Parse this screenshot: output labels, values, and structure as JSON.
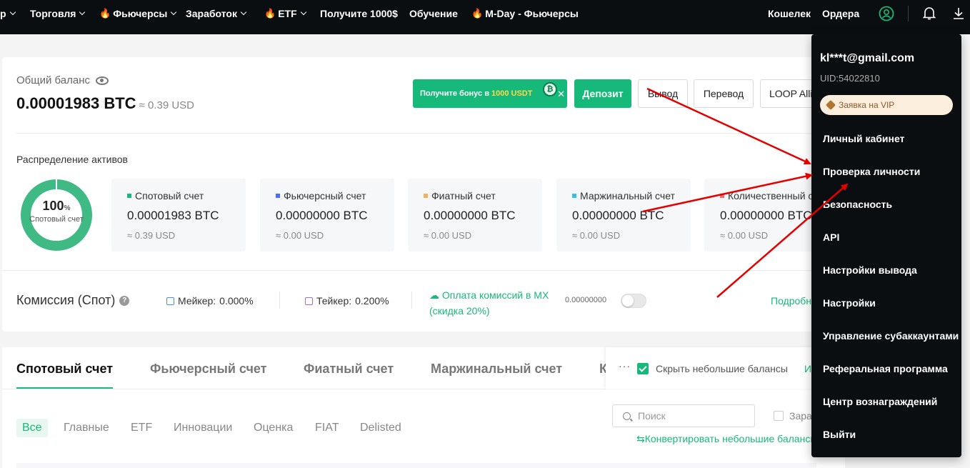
{
  "nav": {
    "items": [
      {
        "label": "р",
        "x": 0
      },
      {
        "label": "Торговля"
      },
      {
        "label": "Фьючерсы"
      },
      {
        "label": "Заработок"
      },
      {
        "label": "ETF"
      },
      {
        "label": "Получите 1000$"
      },
      {
        "label": "Обучение"
      },
      {
        "label": "M-Day - Фьючерсы"
      }
    ],
    "wallet": "Кошелек",
    "orders": "Ордера"
  },
  "balance": {
    "label": "Общий баланс",
    "btc": "0.00001983 BTC",
    "usd": "≈ 0.39 USD"
  },
  "actions": {
    "banner_text": "Получите бонус в",
    "banner_amount": "1000 USDT",
    "deposit": "Депозит",
    "withdraw": "Вывод",
    "transfer": "Перевод",
    "loop": "LOOP Alli"
  },
  "distribution": {
    "label": "Распределение активов",
    "percent": "100",
    "percent_sign": "%",
    "sub": "Спотовый счет",
    "accounts": [
      {
        "name": "Спотовый счет",
        "btc": "0.00001983 BTC",
        "usd": "≈ 0.39 USD",
        "color": "#16b979"
      },
      {
        "name": "Фьючерсный счет",
        "btc": "0.00000000 BTC",
        "usd": "≈ 0.00 USD",
        "color": "#4a6cf7"
      },
      {
        "name": "Фиатный счет",
        "btc": "0.00000000 BTC",
        "usd": "≈ 0.00 USD",
        "color": "#f5b05a"
      },
      {
        "name": "Маржинальный счет",
        "btc": "0.00000000 BTC",
        "usd": "≈ 0.00 USD",
        "color": "#35c0e8"
      },
      {
        "name": "Количественный с",
        "btc": "0.00000000 BTC",
        "usd": "≈ 0.00 USD",
        "color": "#e96f6f"
      }
    ]
  },
  "fees": {
    "title": "Комиссия (Спот)",
    "maker_label": "Мейкер:",
    "maker_value": "0.000%",
    "taker_label": "Тейкер:",
    "taker_value": "0.200%",
    "mx_line1": "Оплата комиссий в MX",
    "mx_line2": "(скидка 20%)",
    "mx_value": "0.00000000",
    "details": "Подробн"
  },
  "tabs": [
    "Спотовый счет",
    "Фьючерсный счет",
    "Фиатный счет",
    "Маржинальный счет",
    "К"
  ],
  "tools": {
    "dots": "···",
    "hide_small": "Скрыть небольшие балансы",
    "extra": "И"
  },
  "filters": [
    "Все",
    "Главные",
    "ETF",
    "Инновации",
    "Оценка",
    "FIAT",
    "Delisted"
  ],
  "search": {
    "placeholder": "Поиск"
  },
  "zar": "Зара",
  "convert": "Конвертировать небольшие балансы",
  "dropdown": {
    "email": "kl***t@gmail.com",
    "uid": "UID:54022810",
    "vip": "Заявка на VIP",
    "items": [
      "Личный кабинет",
      "Проверка личности",
      "Безопасность",
      "API",
      "Настройки вывода",
      "Настройки",
      "Управление субаккаунтами",
      "Реферальная программа",
      "Центр вознаграждений",
      "Выйти"
    ]
  },
  "colors": {
    "accent": "#16b979",
    "nav_bg": "#0b0e11",
    "arrow": "#e50000"
  }
}
